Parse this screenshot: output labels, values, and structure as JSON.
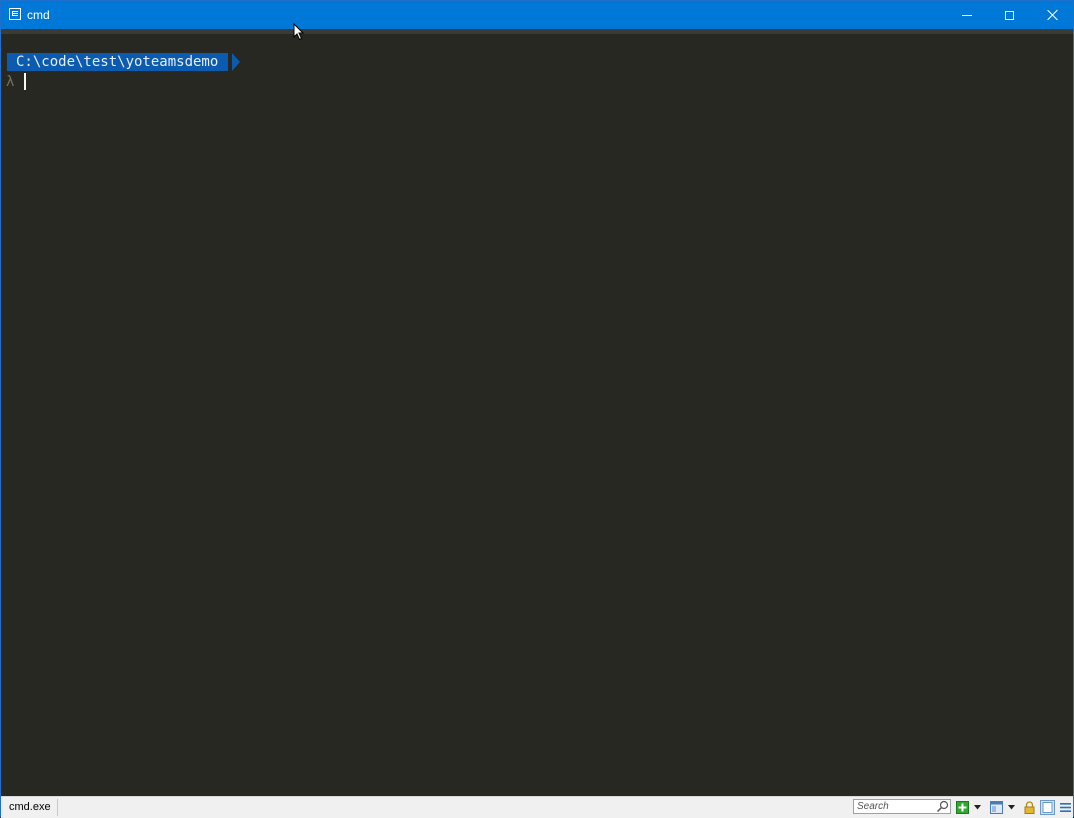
{
  "window": {
    "title": "cmd",
    "app_icon": "console-app-icon",
    "controls": {
      "minimize": "minimize-icon",
      "maximize": "maximize-icon",
      "close": "close-icon"
    }
  },
  "console": {
    "prompt_path": "C:\\code\\test\\yoteamsdemo",
    "prompt_symbol": "λ",
    "background": "#272822",
    "path_highlight": "#0b5bb0"
  },
  "statusbar": {
    "process": "cmd.exe",
    "search_placeholder": "Search",
    "icons": [
      "search-icon",
      "add-tab-icon",
      "dropdown-icon",
      "layout-icon",
      "dropdown-icon",
      "lock-icon",
      "panel-icon",
      "menu-icon"
    ]
  },
  "colors": {
    "titlebar": "#0078d7",
    "statusbar": "#f0f0f0"
  }
}
